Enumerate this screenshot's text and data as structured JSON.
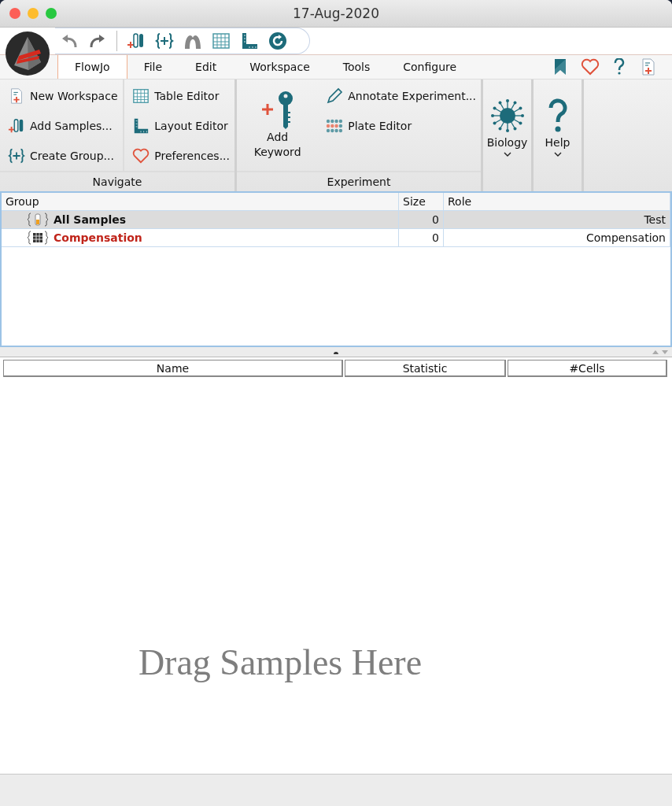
{
  "window": {
    "title": "17-Aug-2020"
  },
  "menu_tabs": [
    {
      "label": "FlowJo",
      "selected": true
    },
    {
      "label": "File",
      "selected": false
    },
    {
      "label": "Edit",
      "selected": false
    },
    {
      "label": "Workspace",
      "selected": false
    },
    {
      "label": "Tools",
      "selected": false
    },
    {
      "label": "Configure",
      "selected": false
    }
  ],
  "ribbon": {
    "navigate": {
      "title": "Navigate",
      "columns": [
        [
          "New Workspace",
          "Add Samples...",
          "Create Group..."
        ],
        [
          "Table Editor",
          "Layout Editor",
          "Preferences..."
        ]
      ]
    },
    "experiment": {
      "title": "Experiment",
      "big_button": [
        "Add",
        "Keyword"
      ],
      "items": [
        "Annotate Experiment...",
        "Plate Editor"
      ]
    },
    "menus": [
      "Biology",
      "Help"
    ]
  },
  "groups_table": {
    "columns": [
      "Group",
      "Size",
      "Role"
    ],
    "rows": [
      {
        "kind": "samples",
        "name": "All Samples",
        "size": "0",
        "role": "Test",
        "selected": true
      },
      {
        "kind": "compensation",
        "name": "Compensation",
        "size": "0",
        "role": "Compensation",
        "selected": false
      }
    ]
  },
  "samples_table": {
    "columns": [
      "Name",
      "Statistic",
      "#Cells"
    ],
    "placeholder": "Drag Samples Here"
  }
}
